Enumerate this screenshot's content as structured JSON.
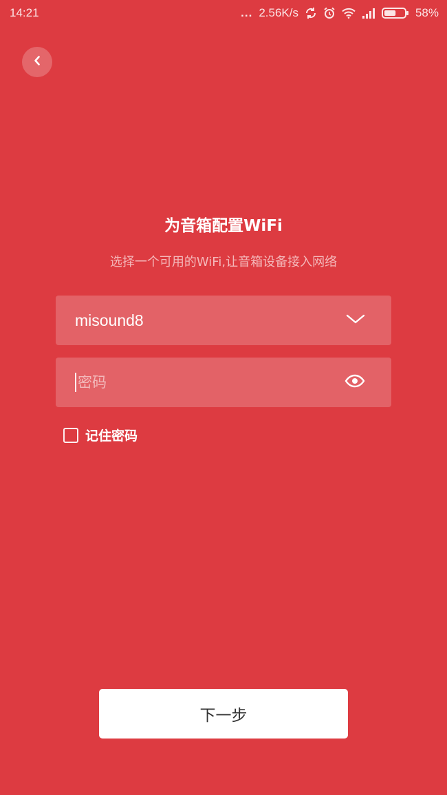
{
  "status_bar": {
    "time": "14:21",
    "dots": "...",
    "network_speed": "2.56K/s",
    "battery_percent": "58%",
    "battery_level": 0.58,
    "icons": [
      "notification-dots-icon",
      "sync-icon",
      "alarm-icon",
      "wifi-icon",
      "signal-icon",
      "battery-icon"
    ]
  },
  "header": {
    "back_icon": "chevron-left-icon"
  },
  "main": {
    "title": "为音箱配置WiFi",
    "subtitle": "选择一个可用的WiFi,让音箱设备接入网络",
    "wifi_select": {
      "value": "misound8",
      "icon": "chevron-down-icon"
    },
    "password_field": {
      "placeholder": "密码",
      "icon": "eye-icon"
    },
    "remember_password": {
      "label": "记住密码",
      "checked": false
    },
    "next_button_label": "下一步"
  },
  "colors": {
    "background": "#dd3b41",
    "field_background": "rgba(255,255,255,0.2)",
    "button_background": "#ffffff",
    "button_text": "#333333"
  }
}
